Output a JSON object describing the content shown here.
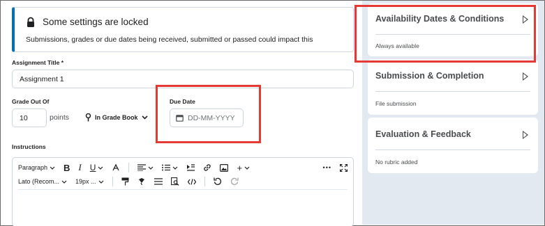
{
  "banner": {
    "title": "Some settings are locked",
    "message": "Submissions, grades or due dates being received, submitted or passed could impact this"
  },
  "assignment_title": {
    "label": "Assignment Title",
    "required_mark": "*",
    "value": "Assignment 1"
  },
  "grade": {
    "label": "Grade Out Of",
    "value": "10",
    "unit": "points",
    "gradebook_label": "In Grade Book"
  },
  "due_date": {
    "label": "Due Date",
    "placeholder": "DD-MM-YYYY"
  },
  "instructions": {
    "label": "Instructions",
    "toolbar": {
      "paragraph": "Paragraph",
      "bold": "B",
      "italic": "I",
      "underline": "U",
      "insert": "+",
      "more": "•••",
      "font": "Lato (Recom...",
      "size": "19px ..."
    }
  },
  "sidebar": {
    "cards": [
      {
        "title": "Availability Dates & Conditions",
        "summary": "Always available"
      },
      {
        "title": "Submission & Completion",
        "summary": "File submission"
      },
      {
        "title": "Evaluation & Feedback",
        "summary": "No rubric added"
      }
    ]
  },
  "highlight_color": "#e53935",
  "accent_color": "#006fbf",
  "icons": [
    "lock-icon",
    "trophy-icon",
    "chevron-down-icon",
    "calendar-icon",
    "caret-right-icon"
  ]
}
